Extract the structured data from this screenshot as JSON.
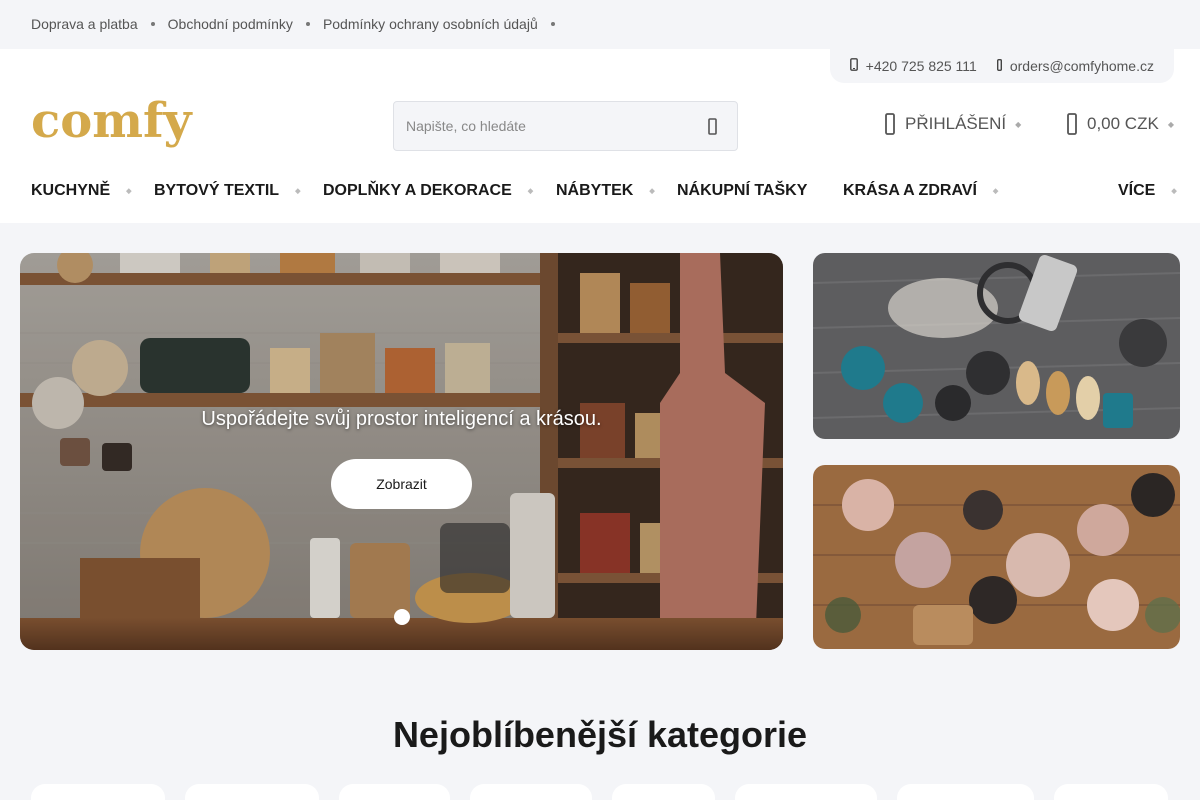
{
  "topbar": {
    "links": [
      "Doprava a platba",
      "Obchodní podmínky",
      "Podmínky ochrany osobních údajů"
    ]
  },
  "header": {
    "phone": "+420 725 825 111",
    "email": "orders@comfyhome.cz",
    "logo": "comfy",
    "search_placeholder": "Napište, co hledáte",
    "login": "PŘIHLÁŠENÍ",
    "cart_total": "0,00 CZK"
  },
  "nav": {
    "items": [
      "KUCHYNĚ",
      "BYTOVÝ TEXTIL",
      "DOPLŇKY A DEKORACE",
      "NÁBYTEK",
      "NÁKUPNÍ TAŠKY",
      "KRÁSA A ZDRAVÍ",
      "VÍCE"
    ]
  },
  "hero": {
    "caption": "Uspořádejte svůj prostor inteligencí a krásou.",
    "button": "Zobrazit"
  },
  "section": {
    "title": "Nejoblíbenější kategorie"
  },
  "colors": {
    "brand_gold": "#d4a94b",
    "background": "#f4f5f8"
  }
}
